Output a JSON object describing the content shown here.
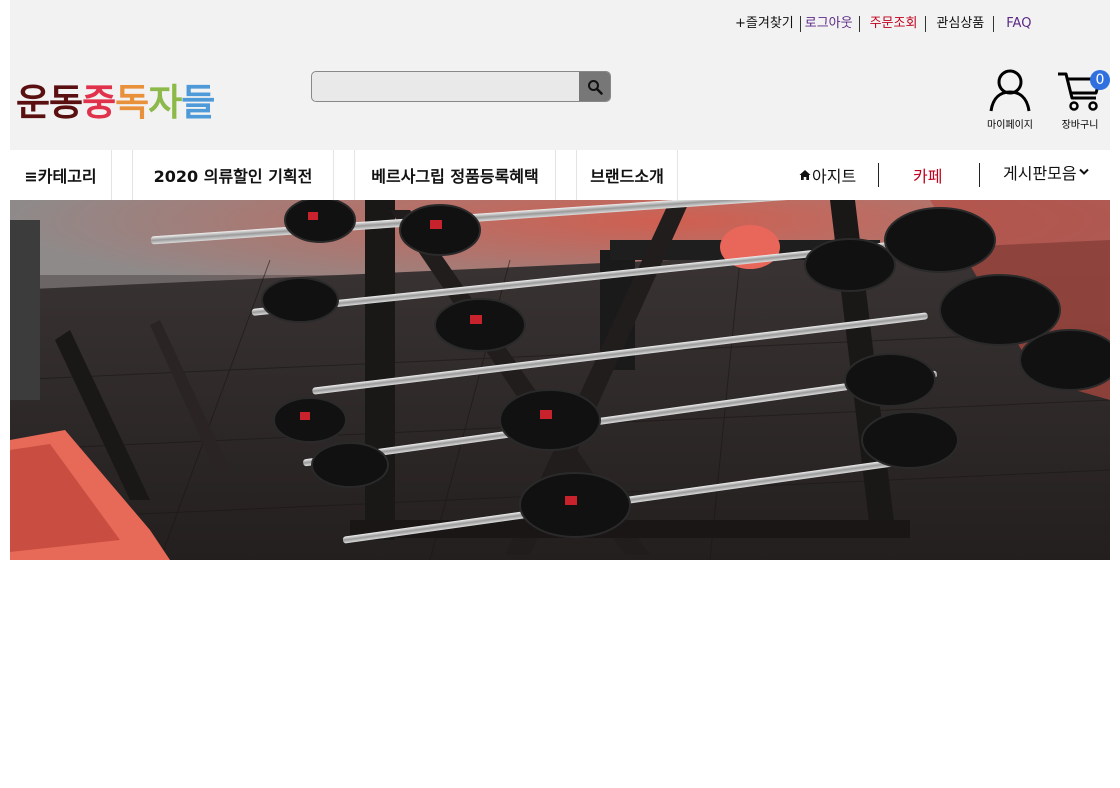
{
  "top_links": {
    "bookmark": "+즐겨찾기",
    "logout": "로그아웃",
    "order_lookup": "주문조회",
    "wishlist": "관심상품",
    "faq": "FAQ"
  },
  "colors": {
    "header_bg": "#f2f2f2",
    "logout": "#5b2a86",
    "order_lookup": "#c0001c",
    "faq": "#5b2a86",
    "cafe": "#c0001c",
    "cart_badge": "#2f6fe0"
  },
  "logo": {
    "chars": [
      {
        "ch": "운",
        "color": "#5a0f10"
      },
      {
        "ch": "동",
        "color": "#5a0f10"
      },
      {
        "ch": "중",
        "color": "#e0324a"
      },
      {
        "ch": "독",
        "color": "#e8913a"
      },
      {
        "ch": "자",
        "color": "#8cb94a"
      },
      {
        "ch": "들",
        "color": "#4e9ad8"
      }
    ]
  },
  "search": {
    "placeholder": "",
    "icon": "search-icon"
  },
  "account": {
    "mypage_label": "마이페이지",
    "cart_label": "장바구니",
    "cart_count": "0"
  },
  "nav": {
    "category": "≡카테고리",
    "tabs": [
      "2020 의류할인 기획전",
      "베르사그립 정품등록혜택",
      "브랜드소개"
    ],
    "home": "아지트",
    "cafe": "카페",
    "board": "게시판모음"
  },
  "banner": {
    "alt": ""
  }
}
